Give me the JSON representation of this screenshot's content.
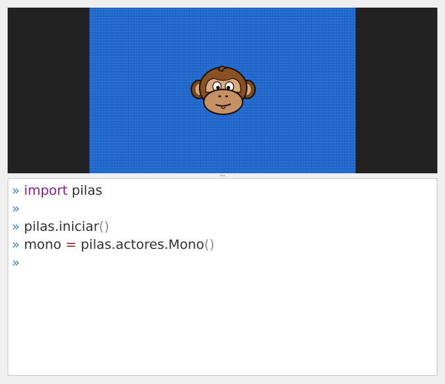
{
  "stage": {
    "background_color": "#2169cf",
    "letterbox_color": "#222222",
    "actor": "monkey-face"
  },
  "console": {
    "prompt": "»",
    "lines": [
      {
        "keyword": "import",
        "module": "pilas"
      },
      {},
      {
        "object": "pilas.iniciar",
        "parens": "()"
      },
      {
        "var": "mono",
        "op": "=",
        "call": "pilas.actores.Mono",
        "parens": "()"
      },
      {}
    ],
    "colors": {
      "prompt": "#3b82d9",
      "keyword": "#8a1a8a",
      "operator": "#8b1a1a",
      "parens": "#8c8c8c",
      "text": "#2f2f2f"
    }
  }
}
